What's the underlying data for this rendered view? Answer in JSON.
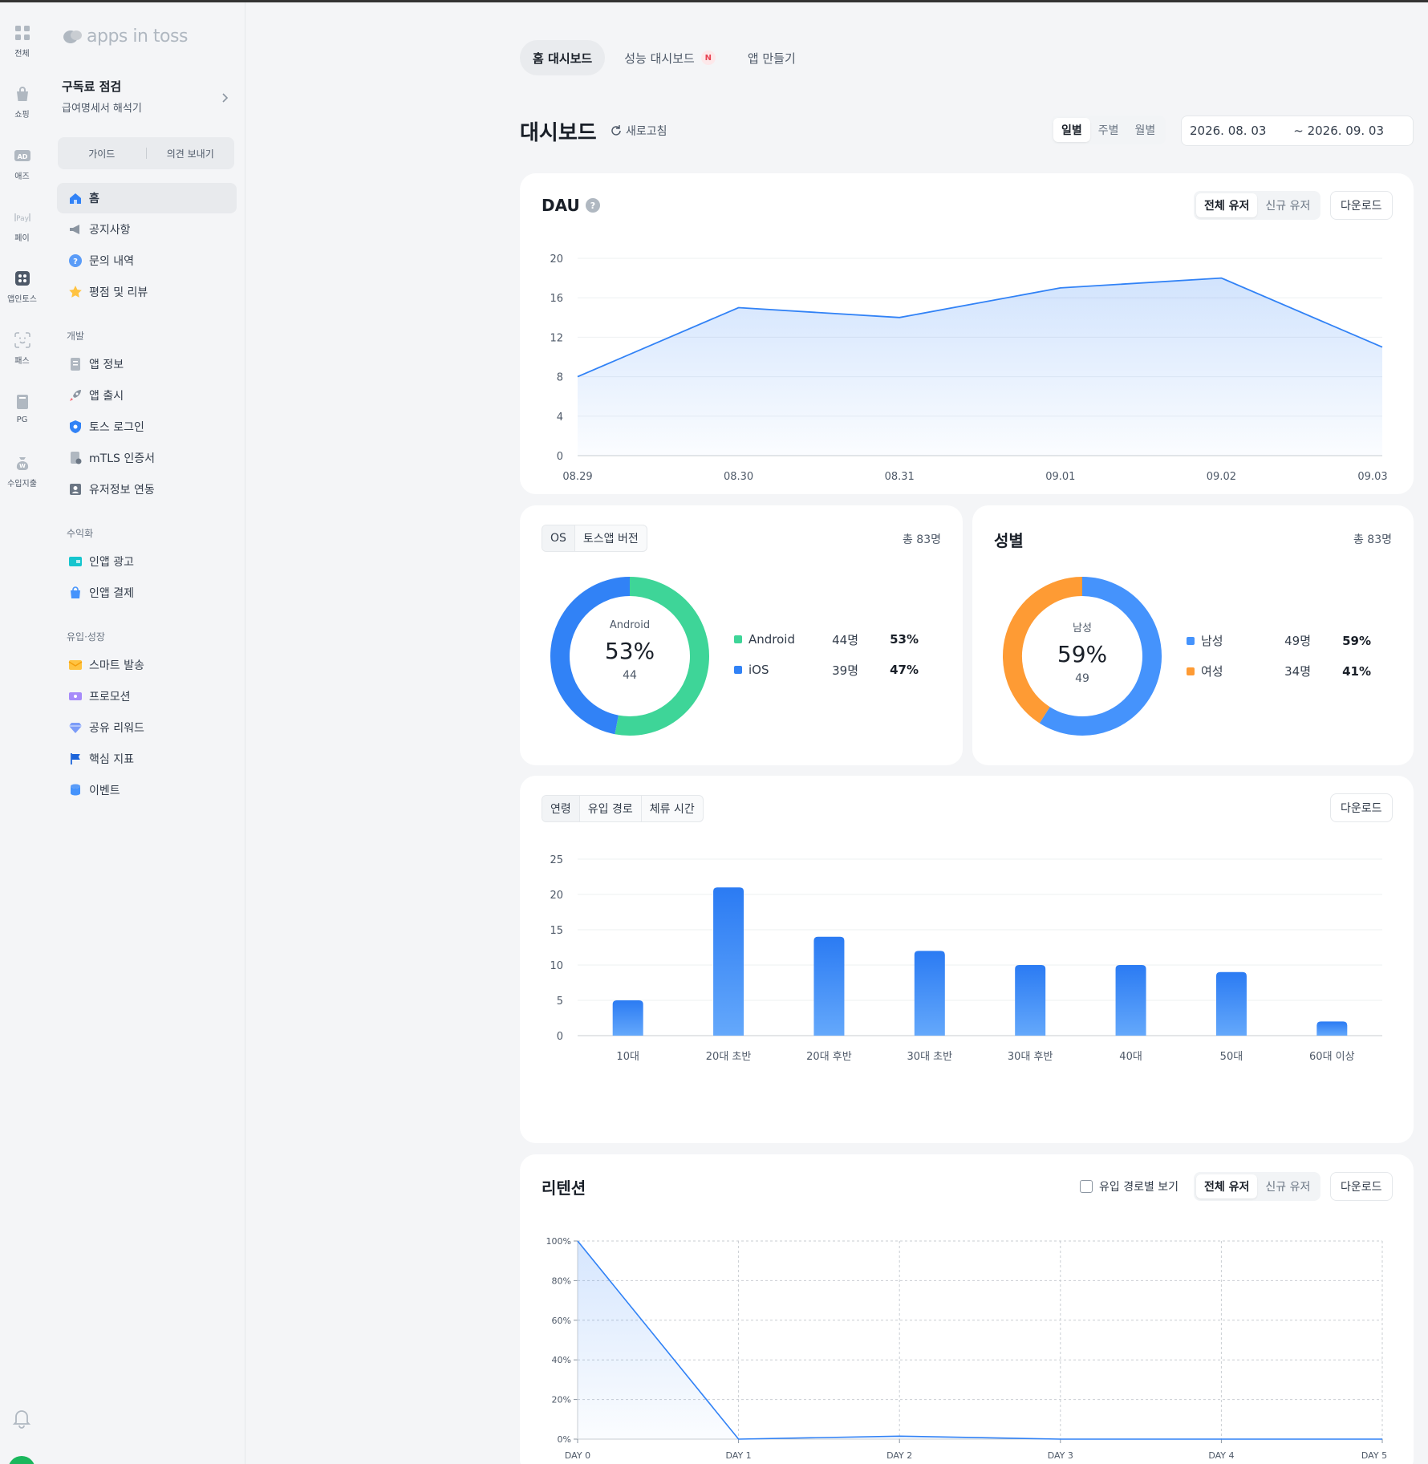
{
  "rail": {
    "items": [
      {
        "label": "전체",
        "icon": "grid-icon"
      },
      {
        "label": "쇼핑",
        "icon": "shopping-bag-icon"
      },
      {
        "label": "애즈",
        "icon": "ad-icon"
      },
      {
        "label": "페이",
        "icon": "pay-icon"
      },
      {
        "label": "앱인토스",
        "icon": "apps-icon"
      },
      {
        "label": "패스",
        "icon": "face-id-icon"
      },
      {
        "label": "PG",
        "icon": "pg-icon"
      },
      {
        "label": "수입지출",
        "icon": "money-bag-icon"
      }
    ]
  },
  "sidebar": {
    "logo": "apps in toss",
    "project_name": "구독료 점검",
    "project_sub": "급여명세서 해석기",
    "guide": "가이드",
    "feedback": "의견 보내기",
    "home": "홈",
    "notice": "공지사항",
    "inquiry": "문의 내역",
    "reviews": "평점 및 리뷰",
    "sections": {
      "dev": {
        "title": "개발",
        "items": [
          "앱 정보",
          "앱 출시",
          "토스 로그인",
          "mTLS 인증서",
          "유저정보 연동"
        ]
      },
      "monetize": {
        "title": "수익화",
        "items": [
          "인앱 광고",
          "인앱 결제"
        ]
      },
      "growth": {
        "title": "유입·성장",
        "items": [
          "스마트 발송",
          "프로모션",
          "공유 리워드",
          "핵심 지표",
          "이벤트"
        ]
      }
    }
  },
  "tabs": {
    "home": "홈 대시보드",
    "perf": "성능 대시보드",
    "perf_badge": "N",
    "make": "앱 만들기"
  },
  "header": {
    "title": "대시보드",
    "refresh": "새로고침",
    "period": {
      "daily": "일별",
      "weekly": "주별",
      "monthly": "월별"
    },
    "date_start": "2026. 08. 03",
    "date_end": "~ 2026. 09. 03"
  },
  "dau": {
    "title": "DAU",
    "all_users": "전체 유저",
    "new_users": "신규 유저",
    "download": "다운로드"
  },
  "os_card": {
    "tab_os": "OS",
    "tab_version": "토스앱 버전",
    "total": "총 83명",
    "center_label": "Android",
    "center_pct": "53%",
    "center_count": "44",
    "rows": [
      {
        "name": "Android",
        "count": "44명",
        "pct": "53%",
        "color": "#3ed598"
      },
      {
        "name": "iOS",
        "count": "39명",
        "pct": "47%",
        "color": "#3182f6"
      }
    ]
  },
  "gender_card": {
    "title": "성별",
    "total": "총 83명",
    "center_label": "남성",
    "center_pct": "59%",
    "center_count": "49",
    "rows": [
      {
        "name": "남성",
        "count": "49명",
        "pct": "59%",
        "color": "#4593fc"
      },
      {
        "name": "여성",
        "count": "34명",
        "pct": "41%",
        "color": "#fe9b34"
      }
    ]
  },
  "age_card": {
    "tab_age": "연령",
    "tab_source": "유입 경로",
    "tab_stay": "체류 시간",
    "download": "다운로드"
  },
  "retention": {
    "title": "리텐션",
    "by_source": "유입 경로별 보기",
    "all_users": "전체 유저",
    "new_users": "신규 유저",
    "download": "다운로드"
  },
  "chart_data": [
    {
      "type": "area",
      "x": [
        "08.29",
        "08.30",
        "08.31",
        "09.01",
        "09.02",
        "09.03"
      ],
      "series": [
        {
          "values": [
            8,
            15,
            14,
            17,
            18,
            11
          ]
        }
      ],
      "ylim": [
        0,
        20
      ],
      "yticks": [
        0,
        4,
        8,
        12,
        16,
        20
      ],
      "grid": true,
      "color": "#3182f6"
    },
    {
      "type": "pie",
      "labels": [
        "Android",
        "iOS"
      ],
      "values": [
        44,
        39
      ],
      "colors": [
        "#3ed598",
        "#3182f6"
      ]
    },
    {
      "type": "pie",
      "labels": [
        "남성",
        "여성"
      ],
      "values": [
        49,
        34
      ],
      "colors": [
        "#4593fc",
        "#fe9b34"
      ]
    },
    {
      "type": "bar",
      "categories": [
        "10대",
        "20대 초반",
        "20대 후반",
        "30대 초반",
        "30대 후반",
        "40대",
        "50대",
        "60대 이상"
      ],
      "values": [
        5,
        21,
        14,
        12,
        10,
        10,
        9,
        2
      ],
      "ylim": [
        0,
        25
      ],
      "yticks": [
        0,
        5,
        10,
        15,
        20,
        25
      ],
      "grid": true,
      "color": "#3182f6"
    },
    {
      "type": "area",
      "x": [
        "DAY 0",
        "DAY 1",
        "DAY 2",
        "DAY 3",
        "DAY 4",
        "DAY 5"
      ],
      "series": [
        {
          "values": [
            100,
            0,
            1.5,
            0,
            0,
            0
          ]
        }
      ],
      "ylim": [
        0,
        100
      ],
      "yticks": [
        "0%",
        "20%",
        "40%",
        "60%",
        "80%",
        "100%"
      ],
      "grid": true,
      "color": "#3182f6"
    }
  ]
}
